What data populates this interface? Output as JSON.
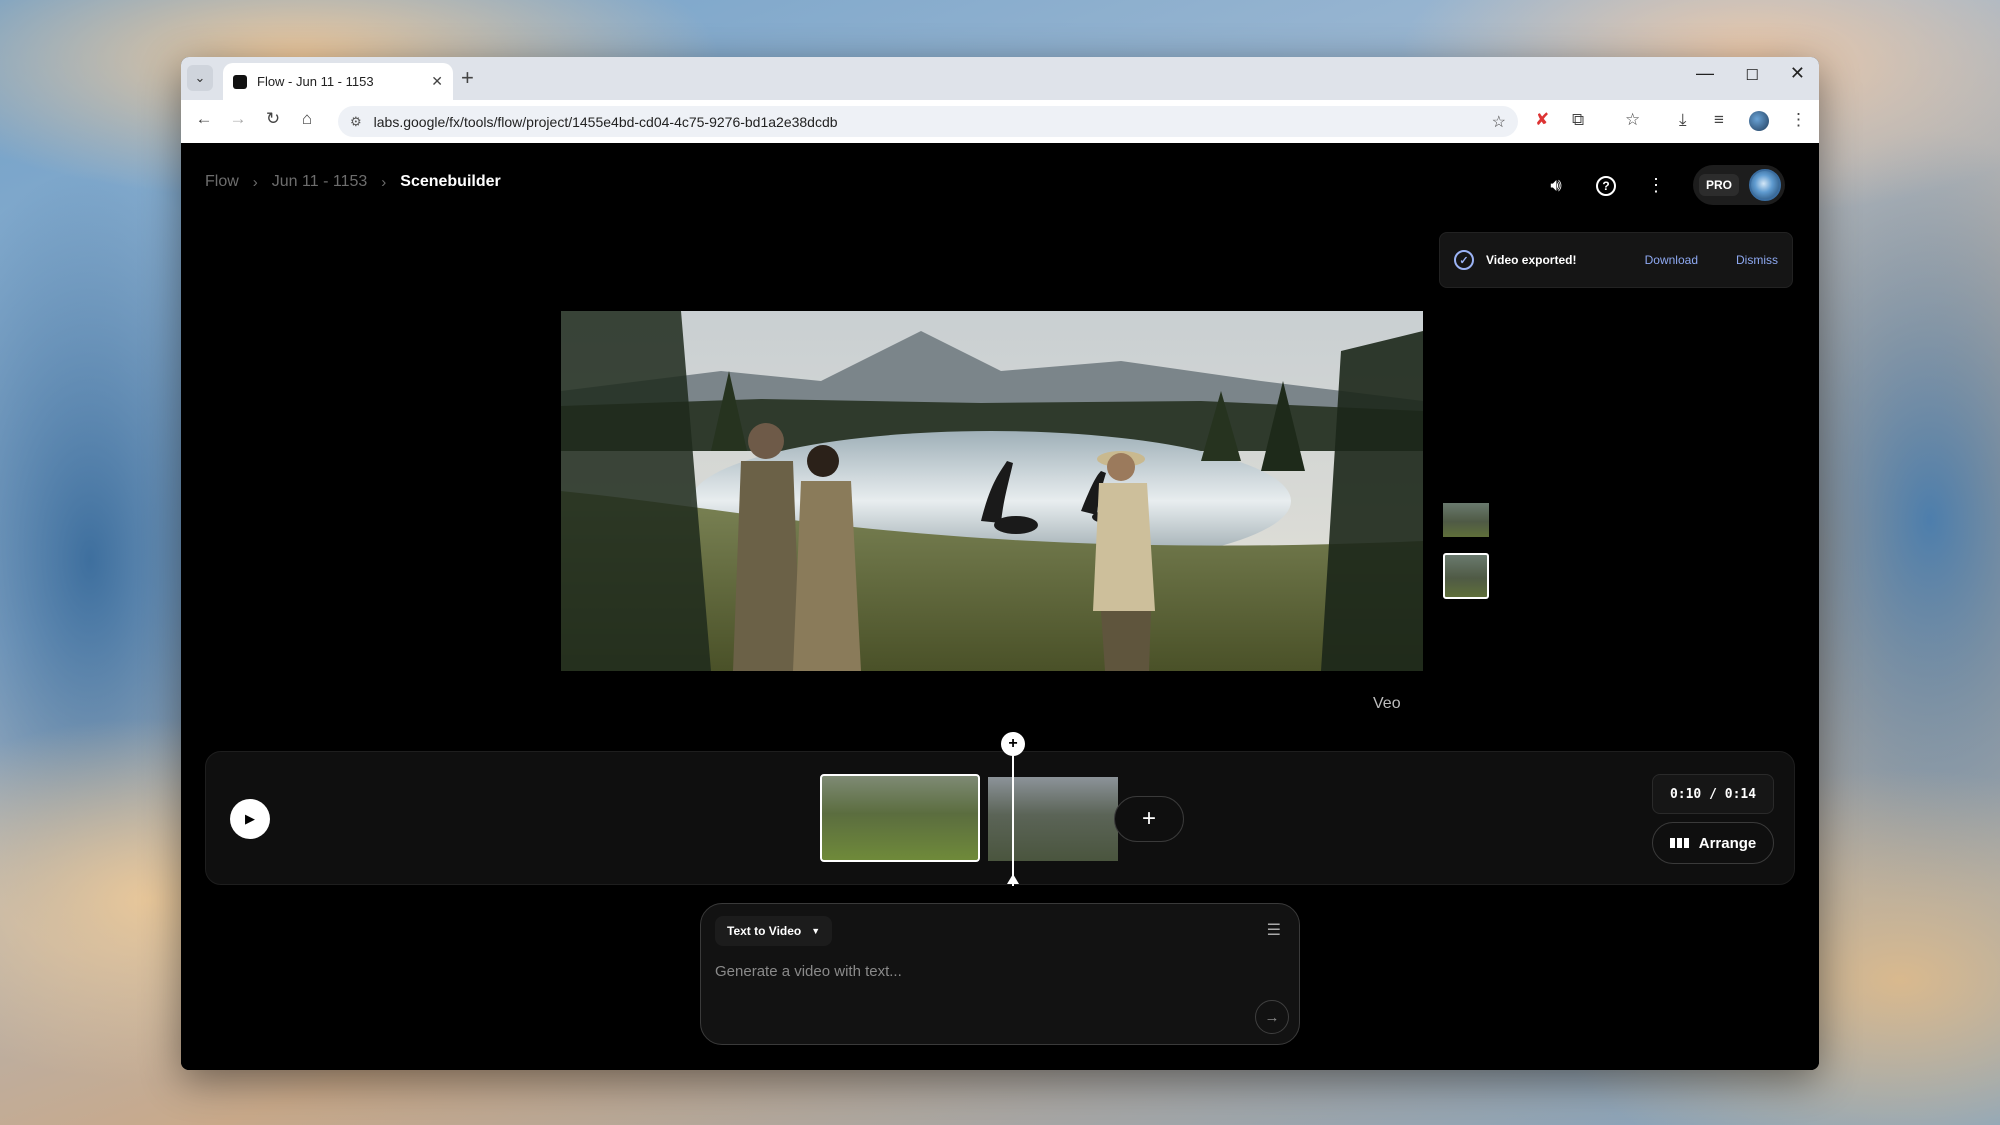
{
  "browser": {
    "tab_title": "Flow - Jun 11 - 1153",
    "url": "labs.google/fx/tools/flow/project/1455e4bd-cd04-4c75-9276-bd1a2e38dcdb",
    "new_tab_label": "+",
    "close_tab_label": "✕",
    "tab_list_label": "⌄",
    "minimize_label": "—",
    "maximize_label": "☐",
    "close_window_label": "✕"
  },
  "breadcrumb": {
    "items": [
      "Flow",
      "Jun 11 - 1153",
      "Scenebuilder"
    ],
    "separator": "›"
  },
  "header": {
    "pro_badge": "PRO",
    "icons": [
      "volume-icon",
      "help-icon",
      "more-vert-icon",
      "avatar"
    ]
  },
  "toast": {
    "message": "Video exported!",
    "download_label": "Download",
    "dismiss_label": "Dismiss"
  },
  "preview": {
    "watermark": "Veo"
  },
  "timeline": {
    "time_display": "0:10 / 0:14",
    "arrange_label": "Arrange",
    "add_clip_label": "+",
    "playhead_add_label": "+",
    "play_label": "▶"
  },
  "prompt": {
    "mode_label": "Text to Video",
    "placeholder": "Generate a video with text...",
    "send_label": "→"
  },
  "colors": {
    "accent": "#8ea9f2",
    "background": "#000000",
    "panel": "#0f0f0f"
  }
}
